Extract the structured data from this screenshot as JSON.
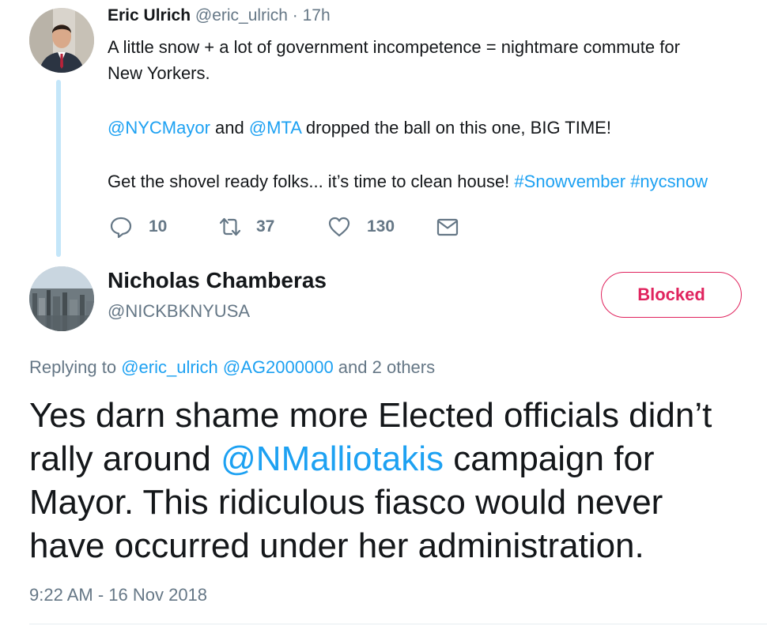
{
  "parent_tweet": {
    "author_name": "Eric Ulrich",
    "author_handle": "@eric_ulrich",
    "separator": "·",
    "time_ago": "17h",
    "text_line1": "A little snow + a lot of government incompetence = nightmare commute for",
    "text_line2": "New Yorkers.",
    "mention1": "@NYCMayor",
    "and_text": " and ",
    "mention2": "@MTA",
    "text_line3_rest": "  dropped the ball on this one, BIG TIME!",
    "text_line4": "Get the shovel ready folks... it’s time to clean house! ",
    "hashtag1": "#Snowvember",
    "hashtag2": "#nycsnow",
    "actions": {
      "reply_icon": "reply-icon",
      "reply_count": "10",
      "retweet_icon": "retweet-icon",
      "retweet_count": "37",
      "like_icon": "heart-icon",
      "like_count": "130",
      "dm_icon": "envelope-icon"
    }
  },
  "reply_tweet": {
    "author_name": "Nicholas Chamberas",
    "author_handle": "@NICKBKNYUSA",
    "blocked_label": "Blocked",
    "replying_prefix": "Replying to ",
    "replying_mention1": "@eric_ulrich",
    "replying_mention2": "@AG2000000",
    "replying_suffix": " and 2 others",
    "body_line1": "Yes darn shame more Elected officials didn’t",
    "body_line2_pre": "rally around ",
    "body_mention": "@NMalliotakis",
    "body_line2_post": " campaign for",
    "body_line3": "Mayor. This ridiculous fiasco would never",
    "body_line4": "have occurred under her administration.",
    "timestamp": "9:22 AM - 16 Nov 2018"
  },
  "colors": {
    "link": "#1da1f2",
    "muted": "#657786",
    "blocked": "#e0245e",
    "thread_line": "#c4e6f9"
  }
}
